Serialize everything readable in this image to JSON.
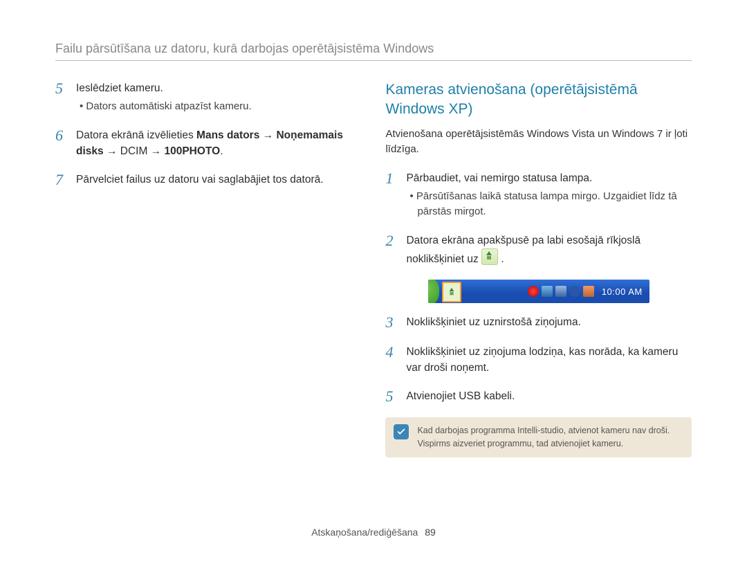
{
  "header": "Failu pārsūtīšana uz datoru, kurā darbojas operētājsistēma Windows",
  "left": {
    "steps": [
      {
        "n": "5",
        "text": "Ieslēdziet kameru.",
        "sub": "Dators automātiski atpazīst kameru."
      },
      {
        "n": "6",
        "prefix": "Datora ekrānā izvēlieties ",
        "bold1": "Mans dators",
        "arrow1": " → ",
        "bold2": "Noņemamais disks",
        "arrow2": " → DCIM → ",
        "bold3": "100PHOTO",
        "suffix": "."
      },
      {
        "n": "7",
        "text": "Pārvelciet failus uz datoru vai saglabājiet tos datorā."
      }
    ]
  },
  "right": {
    "title": "Kameras atvienošana (operētājsistēmā Windows XP)",
    "sub": "Atvienošana operētājsistēmās Windows Vista un Windows 7 ir ļoti līdzīga.",
    "steps": [
      {
        "n": "1",
        "text": "Pārbaudiet, vai nemirgo statusa lampa.",
        "sub": "Pārsūtīšanas laikā statusa lampa mirgo. Uzgaidiet līdz tā pārstās mirgot."
      },
      {
        "n": "2",
        "text_prefix": "Datora ekrāna apakšpusē pa labi esošajā rīkjoslā noklikšķiniet uz ",
        "text_suffix": "."
      },
      {
        "n": "3",
        "text": "Noklikšķiniet uz uznirstošā ziņojuma."
      },
      {
        "n": "4",
        "text": "Noklikšķiniet uz ziņojuma lodziņa, kas norāda, ka kameru var droši noņemt."
      },
      {
        "n": "5",
        "text": "Atvienojiet USB kabeli."
      }
    ],
    "taskbar": {
      "clock": "10:00 AM"
    },
    "note": "Kad darbojas programma Intelli-studio, atvienot kameru nav droši. Vispirms aizveriet programmu, tad atvienojiet kameru."
  },
  "footer": {
    "section": "Atskaņošana/rediģēšana",
    "page": "89"
  }
}
